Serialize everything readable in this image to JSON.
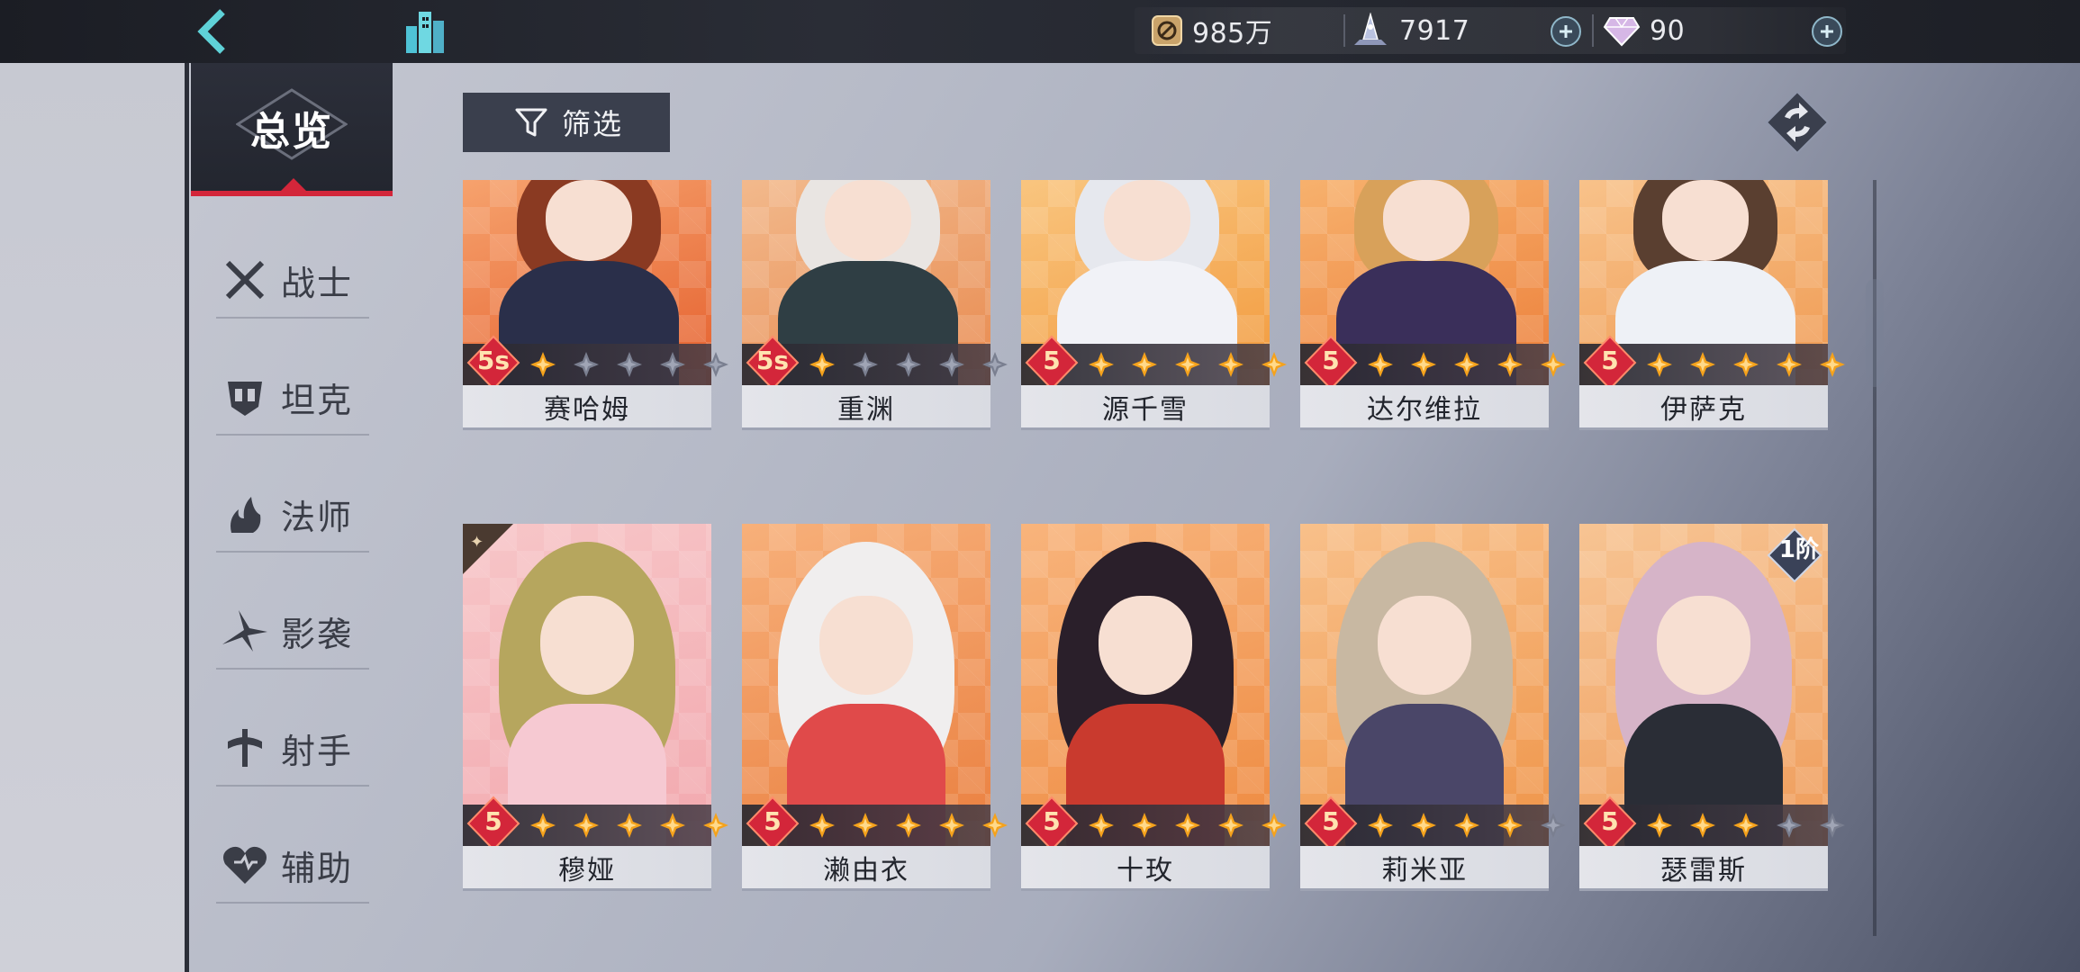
{
  "topbar": {
    "resources": {
      "gold": {
        "value": "985万",
        "icon": "coin-icon"
      },
      "stamina": {
        "value": "7917",
        "icon": "crystal-tower-icon"
      },
      "gems": {
        "value": "90",
        "icon": "diamond-icon"
      }
    }
  },
  "sidebar": {
    "overview_label": "总览",
    "items": [
      {
        "label": "战士",
        "icon": "crossed-swords-icon"
      },
      {
        "label": "坦克",
        "icon": "shield-helmet-icon"
      },
      {
        "label": "法师",
        "icon": "staff-flame-icon"
      },
      {
        "label": "影袭",
        "icon": "shuriken-icon"
      },
      {
        "label": "射手",
        "icon": "crosshair-icon"
      },
      {
        "label": "辅助",
        "icon": "heart-icon"
      }
    ]
  },
  "filter": {
    "label": "筛选"
  },
  "colors": {
    "accent_red": "#d3263a",
    "star_lit": "#f5a21b",
    "star_dim": "#7a7f90",
    "card_orange": "#f28f3f"
  },
  "characters": [
    {
      "name": "赛哈姆",
      "rank": "5s",
      "stars_lit": 1,
      "stars_total": 5
    },
    {
      "name": "重渊",
      "rank": "5s",
      "stars_lit": 1,
      "stars_total": 5
    },
    {
      "name": "源千雪",
      "rank": "5",
      "stars_lit": 5,
      "stars_total": 5
    },
    {
      "name": "达尔维拉",
      "rank": "5",
      "stars_lit": 5,
      "stars_total": 5
    },
    {
      "name": "伊萨克",
      "rank": "5",
      "stars_lit": 5,
      "stars_total": 5
    },
    {
      "name": "穆娅",
      "rank": "5",
      "stars_lit": 5,
      "stars_total": 5,
      "faction_mark": true
    },
    {
      "name": "濑由衣",
      "rank": "5",
      "stars_lit": 5,
      "stars_total": 5
    },
    {
      "name": "十玫",
      "rank": "5",
      "stars_lit": 5,
      "stars_total": 5
    },
    {
      "name": "莉米亚",
      "rank": "5",
      "stars_lit": 4,
      "stars_total": 5
    },
    {
      "name": "瑟雷斯",
      "rank": "5",
      "stars_lit": 3,
      "stars_total": 5,
      "tier": "1阶"
    }
  ]
}
